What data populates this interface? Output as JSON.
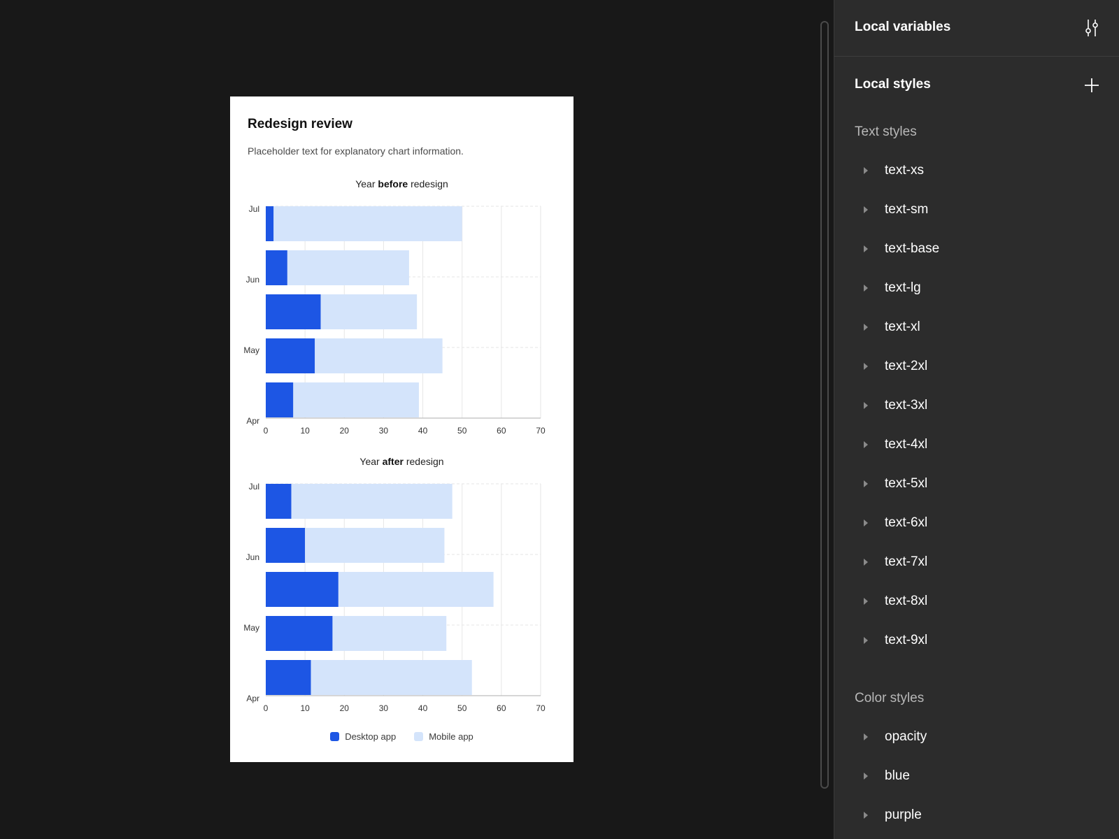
{
  "card": {
    "title": "Redesign review",
    "subtitle": "Placeholder text for explanatory chart information."
  },
  "charts": {
    "before": {
      "prefix": "Year ",
      "bold": "before",
      "suffix": " redesign"
    },
    "after": {
      "prefix": "Year ",
      "bold": "after",
      "suffix": " redesign"
    }
  },
  "legend": {
    "desktop": "Desktop app",
    "mobile": "Mobile app"
  },
  "colors": {
    "desktop": "#1d56e4",
    "mobile": "#d4e4fb",
    "grid": "#e6e6e6",
    "axis": "#bdbdbd"
  },
  "chart_data": [
    {
      "type": "bar",
      "orientation": "horizontal",
      "stacked": true,
      "title": "Year before redesign",
      "y_tick_labels": [
        "Jul",
        "Jun",
        "May",
        "Apr"
      ],
      "x_ticks": [
        0,
        10,
        20,
        30,
        40,
        50,
        60,
        70
      ],
      "xlim": [
        0,
        70
      ],
      "series": [
        {
          "name": "Desktop app",
          "values": [
            2,
            5.5,
            14,
            12.5,
            7
          ]
        },
        {
          "name": "Mobile app",
          "values": [
            48,
            31,
            24.5,
            32.5,
            32
          ]
        }
      ],
      "grid": true
    },
    {
      "type": "bar",
      "orientation": "horizontal",
      "stacked": true,
      "title": "Year after redesign",
      "y_tick_labels": [
        "Jul",
        "Jun",
        "May",
        "Apr"
      ],
      "x_ticks": [
        0,
        10,
        20,
        30,
        40,
        50,
        60,
        70
      ],
      "xlim": [
        0,
        70
      ],
      "series": [
        {
          "name": "Desktop app",
          "values": [
            6.5,
            10,
            18.5,
            17,
            11.5
          ]
        },
        {
          "name": "Mobile app",
          "values": [
            41,
            35.5,
            39.5,
            29,
            41
          ]
        }
      ],
      "grid": true,
      "legend": "bottom-center"
    }
  ],
  "panel": {
    "variables_title": "Local variables",
    "variables_icon": "sliders-icon",
    "styles_title": "Local styles",
    "add_icon": "plus-icon",
    "text_styles_label": "Text styles",
    "text_styles": [
      "text-xs",
      "text-sm",
      "text-base",
      "text-lg",
      "text-xl",
      "text-2xl",
      "text-3xl",
      "text-4xl",
      "text-5xl",
      "text-6xl",
      "text-7xl",
      "text-8xl",
      "text-9xl"
    ],
    "color_styles_label": "Color styles",
    "color_styles": [
      "opacity",
      "blue",
      "purple"
    ]
  }
}
